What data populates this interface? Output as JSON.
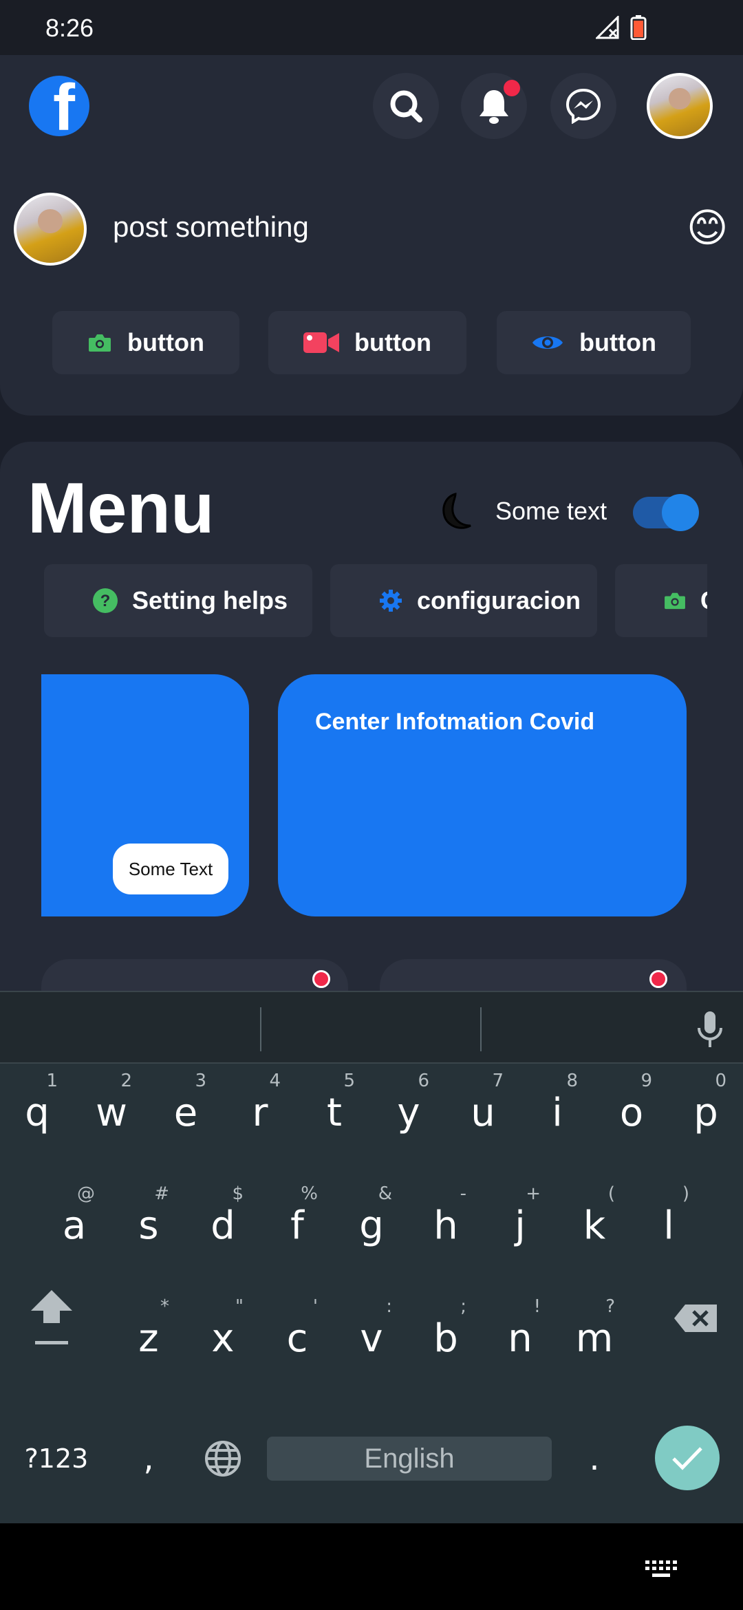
{
  "status_bar": {
    "time": "8:26"
  },
  "header": {
    "logo_letter": "f",
    "icons": [
      "search-icon",
      "bell-icon",
      "messenger-icon"
    ]
  },
  "composer": {
    "placeholder": "post something",
    "emoji": "😊",
    "actions": [
      {
        "label": "button",
        "icon": "camera-icon",
        "color": "#45bd62"
      },
      {
        "label": "button",
        "icon": "video-icon",
        "color": "#f3425f"
      },
      {
        "label": "button",
        "icon": "eye-icon",
        "color": "#1877f2"
      }
    ]
  },
  "menu": {
    "title": "Menu",
    "toggle_label": "Some text",
    "toggle_on": true,
    "chips": [
      {
        "label": "Setting helps",
        "icon": "help-icon"
      },
      {
        "label": "configuracion",
        "icon": "gear-icon"
      },
      {
        "label": "C",
        "icon": "camera-icon"
      }
    ],
    "card_left_button": "Some Text",
    "card_right_title": "Center Infotmation Covid"
  },
  "keyboard": {
    "row1": [
      {
        "k": "q",
        "a": "1"
      },
      {
        "k": "w",
        "a": "2"
      },
      {
        "k": "e",
        "a": "3"
      },
      {
        "k": "r",
        "a": "4"
      },
      {
        "k": "t",
        "a": "5"
      },
      {
        "k": "y",
        "a": "6"
      },
      {
        "k": "u",
        "a": "7"
      },
      {
        "k": "i",
        "a": "8"
      },
      {
        "k": "o",
        "a": "9"
      },
      {
        "k": "p",
        "a": "0"
      }
    ],
    "row2": [
      {
        "k": "a",
        "a": "@"
      },
      {
        "k": "s",
        "a": "#"
      },
      {
        "k": "d",
        "a": "$"
      },
      {
        "k": "f",
        "a": "%"
      },
      {
        "k": "g",
        "a": "&"
      },
      {
        "k": "h",
        "a": "-"
      },
      {
        "k": "j",
        "a": "+"
      },
      {
        "k": "k",
        "a": "("
      },
      {
        "k": "l",
        "a": ")"
      }
    ],
    "row3": [
      {
        "k": "z",
        "a": "*"
      },
      {
        "k": "x",
        "a": "\""
      },
      {
        "k": "c",
        "a": "'"
      },
      {
        "k": "v",
        "a": ":"
      },
      {
        "k": "b",
        "a": ";"
      },
      {
        "k": "n",
        "a": "!"
      },
      {
        "k": "m",
        "a": "?"
      }
    ],
    "symbols_label": "?123",
    "comma": ",",
    "period": ".",
    "space_label": "English"
  },
  "colors": {
    "accent": "#1877f2",
    "background": "#1b1f2a",
    "panel": "#252a37",
    "keyboard": "#263238",
    "enter": "#80cbc4"
  }
}
